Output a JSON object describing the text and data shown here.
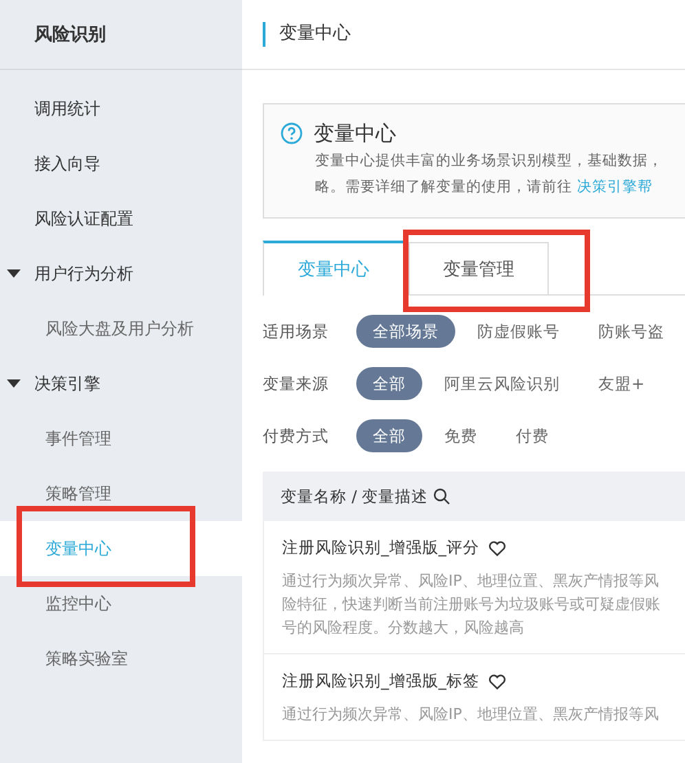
{
  "sidebar": {
    "title": "风险识别",
    "items": [
      {
        "label": "调用统计",
        "selected": false,
        "highlighted": false
      },
      {
        "label": "接入向导",
        "selected": false,
        "highlighted": false
      },
      {
        "label": "风险认证配置",
        "selected": false,
        "highlighted": false
      },
      {
        "label": "用户行为分析",
        "expanded": true,
        "selected": false,
        "highlighted": false,
        "children": [
          {
            "label": "风险大盘及用户分析",
            "selected": false,
            "highlighted": false
          }
        ]
      },
      {
        "label": "决策引擎",
        "expanded": true,
        "selected": false,
        "highlighted": false,
        "children": [
          {
            "label": "事件管理",
            "selected": false,
            "highlighted": false
          },
          {
            "label": "策略管理",
            "selected": false,
            "highlighted": false
          },
          {
            "label": "变量中心",
            "selected": true,
            "highlighted": true
          },
          {
            "label": "监控中心",
            "selected": false,
            "highlighted": false
          },
          {
            "label": "策略实验室",
            "selected": false,
            "highlighted": false
          }
        ]
      }
    ]
  },
  "page_title": "变量中心",
  "info": {
    "title": "变量中心",
    "lines": [
      "变量中心提供丰富的业务场景识别模型，基础数据，",
      "略。需要详细了解变量的使用，请前往 "
    ],
    "link": "决策引擎帮"
  },
  "tabs": [
    {
      "label": "变量中心",
      "selected": true,
      "highlighted": false
    },
    {
      "label": "变量管理",
      "selected": false,
      "highlighted": true
    }
  ],
  "filters": [
    {
      "label": "适用场景",
      "options": [
        {
          "label": "全部场景",
          "selected": true
        },
        {
          "label": "防虚假账号",
          "selected": false
        },
        {
          "label": "防账号盗",
          "selected": false
        }
      ]
    },
    {
      "label": "变量来源",
      "options": [
        {
          "label": "全部",
          "selected": true
        },
        {
          "label": "阿里云风险识别",
          "selected": false
        },
        {
          "label": "友盟+",
          "selected": false
        }
      ]
    },
    {
      "label": "付费方式",
      "options": [
        {
          "label": "全部",
          "selected": true
        },
        {
          "label": "免费",
          "selected": false
        },
        {
          "label": "付费",
          "selected": false
        }
      ]
    }
  ],
  "table": {
    "header": "变量名称 / 变量描述",
    "rows": [
      {
        "name": "注册风险识别_增强版_评分",
        "description": [
          "通过行为频次异常、风险IP、地理位置、黑灰产情报等风",
          "险特征，快速判断当前注册账号为垃圾账号或可疑虚假账",
          "号的风险程度。分数越大，风险越高"
        ]
      },
      {
        "name": "注册风险识别_增强版_标签",
        "description": [
          "通过行为频次异常、风险IP、地理位置、黑灰产情报等风"
        ]
      }
    ]
  }
}
